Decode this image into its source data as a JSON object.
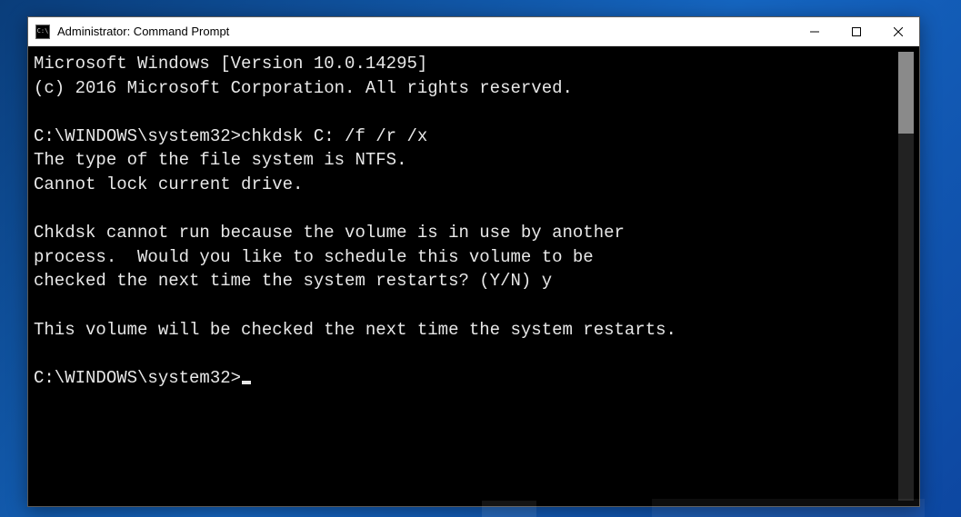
{
  "window": {
    "title": "Administrator: Command Prompt",
    "icon_label": "C:\\"
  },
  "console": {
    "line1": "Microsoft Windows [Version 10.0.14295]",
    "line2": "(c) 2016 Microsoft Corporation. All rights reserved.",
    "blank1": "",
    "prompt1": "C:\\WINDOWS\\system32>chkdsk C: /f /r /x",
    "out1": "The type of the file system is NTFS.",
    "out2": "Cannot lock current drive.",
    "blank2": "",
    "out3": "Chkdsk cannot run because the volume is in use by another",
    "out4": "process.  Would you like to schedule this volume to be",
    "out5": "checked the next time the system restarts? (Y/N) y",
    "blank3": "",
    "out6": "This volume will be checked the next time the system restarts.",
    "blank4": "",
    "prompt2": "C:\\WINDOWS\\system32>"
  }
}
